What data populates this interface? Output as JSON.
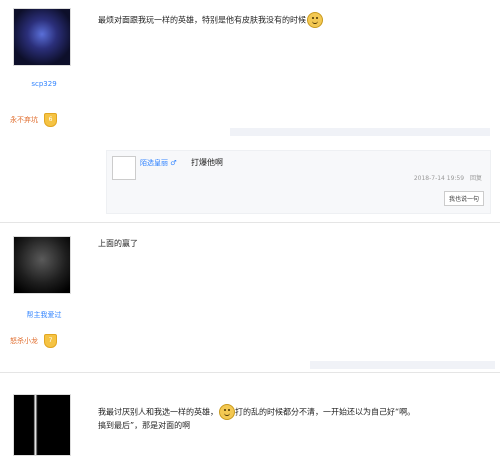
{
  "posts": [
    {
      "username": "scp329",
      "level_name": "永不弃坑",
      "level_num": "6",
      "content": "最烦对面跟我玩一样的英雄，特别是他有皮肤我没有的时候"
    },
    {
      "username": "帮主我爱过",
      "level_name": "怒杀小龙",
      "level_num": "7",
      "content": "上面的赢了"
    },
    {
      "username": "",
      "level_name": "",
      "level_num": "",
      "content_line1a": "我最讨厌别人和我选一样的英雄，",
      "content_line1b": "打的乱的时候都分不清，一开始还以为自己好“啊。",
      "content_line2": "搞到最后”，那是对面的啊"
    }
  ],
  "reply": {
    "name": "陌选皇丽",
    "gender_mark": "♂",
    "text": "打爆他啊",
    "timestamp": "2018-7-14 19:59",
    "reply_label": "回复",
    "button_label": "我也说一句"
  }
}
